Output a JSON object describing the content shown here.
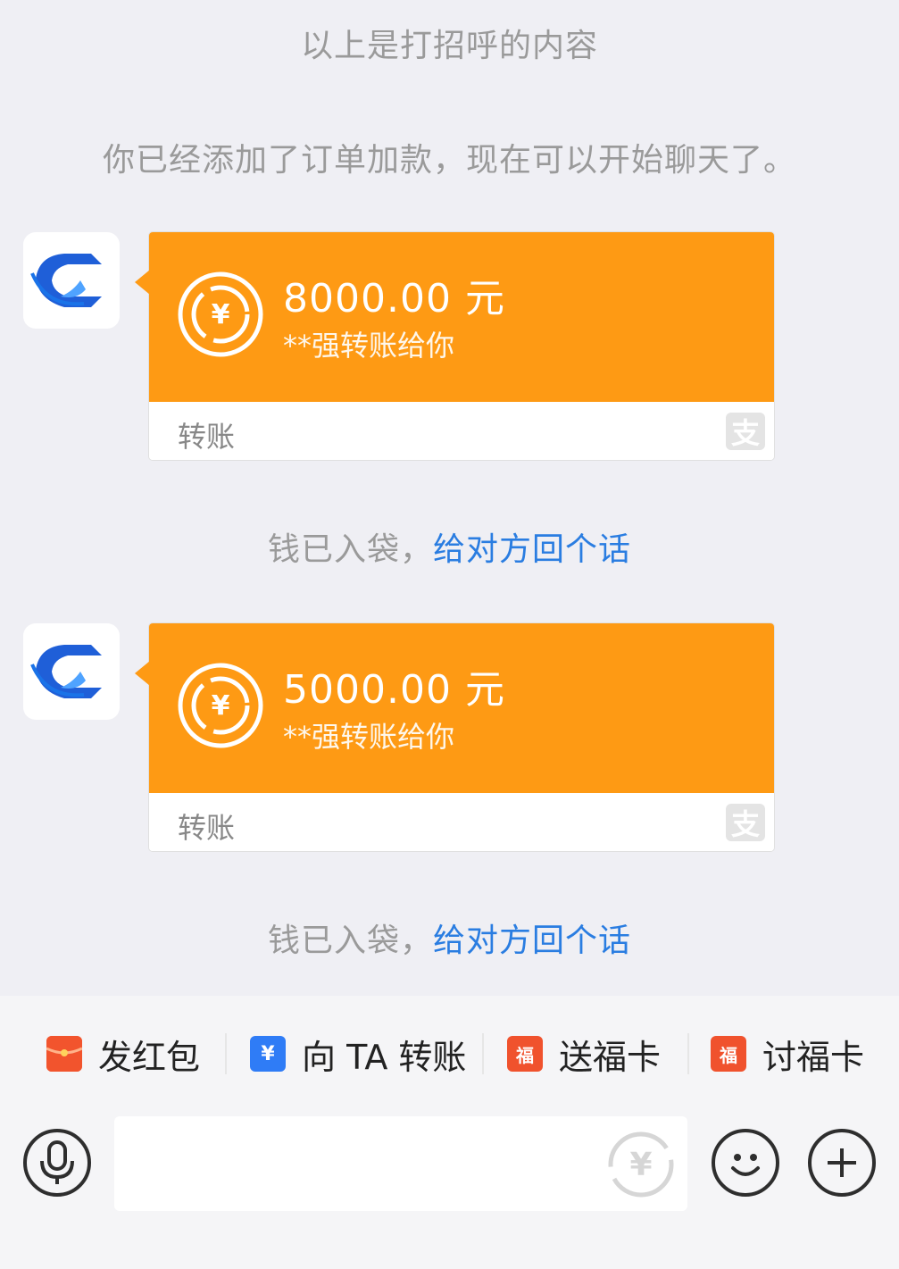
{
  "chat": {
    "greeting_note": "以上是打招呼的内容",
    "added_note": "你已经添加了订单加款，现在可以开始聊天了。",
    "messages": [
      {
        "amount": "8000.00 元",
        "from_text": "**强转账给你",
        "type_label": "转账",
        "receipt_plain": "钱已入袋，",
        "receipt_link": "给对方回个话"
      },
      {
        "amount": "5000.00 元",
        "from_text": "**强转账给你",
        "type_label": "转账",
        "receipt_plain": "钱已入袋，",
        "receipt_link": "给对方回个话"
      }
    ]
  },
  "quick_actions": [
    {
      "label": "发红包",
      "icon": "red-packet-icon"
    },
    {
      "label": "向 TA 转账",
      "icon": "transfer-icon"
    },
    {
      "label": "送福卡",
      "icon": "fu-card-icon"
    },
    {
      "label": "讨福卡",
      "icon": "fu-card-icon"
    }
  ],
  "input_bar": {
    "placeholder": "",
    "icons": [
      "microphone-icon",
      "yuan-icon",
      "emoji-icon",
      "plus-icon"
    ]
  },
  "colors": {
    "card_orange": "#fe9a14",
    "link_blue": "#2a7de1",
    "background": "#efeff4"
  }
}
